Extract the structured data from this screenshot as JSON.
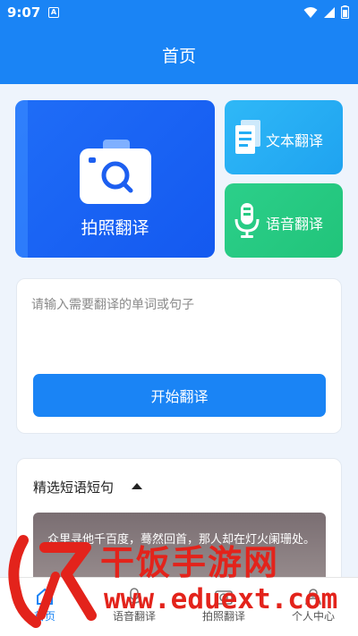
{
  "status": {
    "time": "9:07",
    "notif_letter": "A"
  },
  "appbar": {
    "title": "首页"
  },
  "features": {
    "photo": {
      "label": "拍照翻译"
    },
    "text": {
      "label": "文本翻译"
    },
    "voice": {
      "label": "语音翻译"
    }
  },
  "input": {
    "placeholder": "请输入需要翻译的单词或句子",
    "value": "",
    "button": "开始翻译"
  },
  "phrases": {
    "title": "精选短语短句",
    "items": [
      {
        "text": "众里寻他千百度，蓦然回首，那人却在灯火阑珊处。"
      }
    ]
  },
  "nav": {
    "items": [
      {
        "label": "首页",
        "icon": "home-icon"
      },
      {
        "label": "语音翻译",
        "icon": "mic-icon"
      },
      {
        "label": "拍照翻译",
        "icon": "camera-icon"
      },
      {
        "label": "个人中心",
        "icon": "person-icon"
      }
    ]
  },
  "watermark": {
    "main": "干饭手游网",
    "url": "www.eduext.com"
  },
  "colors": {
    "primary": "#1a84f5",
    "photo": "#1a63f3",
    "text": "#26aef5",
    "voice": "#26ca82",
    "watermark": "#e3231b"
  }
}
